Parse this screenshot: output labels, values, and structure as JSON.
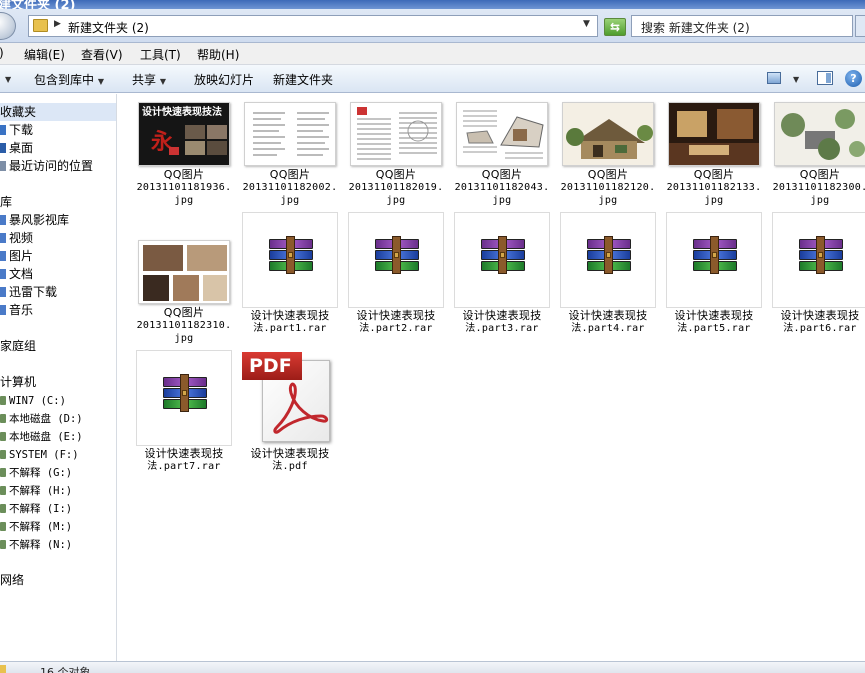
{
  "window": {
    "title_fragment": "建文件夹 (2)"
  },
  "address": {
    "path": "新建文件夹 (2)",
    "search_placeholder": "搜索 新建文件夹 (2)"
  },
  "menu": [
    {
      "label": ")"
    },
    {
      "label": "编辑(E)"
    },
    {
      "label": "查看(V)"
    },
    {
      "label": "工具(T)"
    },
    {
      "label": "帮助(H)"
    }
  ],
  "commands": {
    "include_in_library": "包含到库中",
    "share": "共享",
    "slideshow": "放映幻灯片",
    "new_folder": "新建文件夹"
  },
  "nav": {
    "favorites": "收藏夹",
    "downloads": "下载",
    "desktop": "桌面",
    "recent": "最近访问的位置",
    "libraries": "库",
    "storm": "暴风影视库",
    "videos": "视频",
    "pictures": "图片",
    "documents": "文档",
    "xunlei": "迅雷下载",
    "music": "音乐",
    "homegroup": "家庭组",
    "computer": "计算机",
    "drives": [
      "WIN7 (C:)",
      "本地磁盘 (D:)",
      "本地磁盘 (E:)",
      "SYSTEM (F:)",
      "不解释 (G:)",
      "不解释 (H:)",
      "不解释 (I:)",
      "不解释 (M:)",
      "不解释 (N:)"
    ],
    "network": "网络"
  },
  "files": [
    {
      "name1": "QQ图片",
      "name2": "20131101181936.",
      "name3": "jpg",
      "kind": "image"
    },
    {
      "name1": "QQ图片",
      "name2": "20131101182002.",
      "name3": "jpg",
      "kind": "image"
    },
    {
      "name1": "QQ图片",
      "name2": "20131101182019.",
      "name3": "jpg",
      "kind": "image"
    },
    {
      "name1": "QQ图片",
      "name2": "20131101182043.",
      "name3": "jpg",
      "kind": "image"
    },
    {
      "name1": "QQ图片",
      "name2": "20131101182120.",
      "name3": "jpg",
      "kind": "image"
    },
    {
      "name1": "QQ图片",
      "name2": "20131101182133.",
      "name3": "jpg",
      "kind": "image"
    },
    {
      "name1": "QQ图片",
      "name2": "20131101182300.",
      "name3": "jpg",
      "kind": "image"
    },
    {
      "name1": "QQ图片",
      "name2": "20131101182310.",
      "name3": "jpg",
      "kind": "image"
    },
    {
      "name1": "设计快速表现技",
      "name2": "法.part1.rar",
      "kind": "rar"
    },
    {
      "name1": "设计快速表现技",
      "name2": "法.part2.rar",
      "kind": "rar"
    },
    {
      "name1": "设计快速表现技",
      "name2": "法.part3.rar",
      "kind": "rar"
    },
    {
      "name1": "设计快速表现技",
      "name2": "法.part4.rar",
      "kind": "rar"
    },
    {
      "name1": "设计快速表现技",
      "name2": "法.part5.rar",
      "kind": "rar"
    },
    {
      "name1": "设计快速表现技",
      "name2": "法.part6.rar",
      "kind": "rar"
    },
    {
      "name1": "设计快速表现技",
      "name2": "法.part7.rar",
      "kind": "rar"
    },
    {
      "name1": "设计快速表现技",
      "name2": "法.pdf",
      "kind": "pdf"
    }
  ],
  "thumb_texts": {
    "cover_title": "设计快速表现技法",
    "pdf_badge": "PDF"
  },
  "status": {
    "count": "16 个对象"
  },
  "icons": {
    "back": "back-arrow-icon",
    "folder": "folder-icon",
    "refresh": "refresh-icon",
    "search": "search-icon",
    "views": "views-icon",
    "preview_pane": "preview-pane-icon",
    "help": "help-icon"
  }
}
